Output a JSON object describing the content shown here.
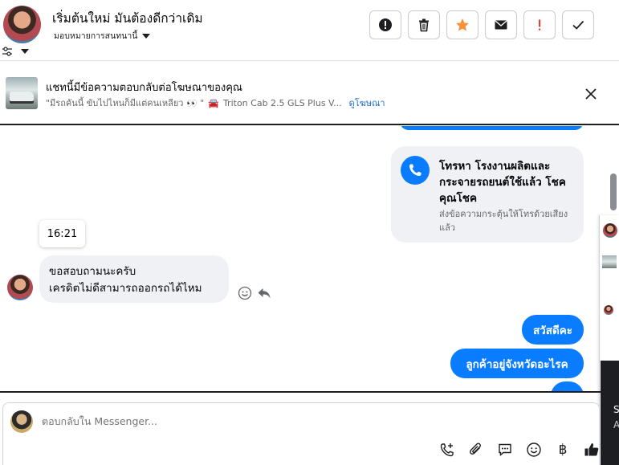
{
  "header": {
    "title": "เริ่มต้นใหม่ มันต้องดีกว่าเดิม",
    "assign_label": "มอบหมายการสนทนานี้",
    "actions": [
      {
        "name": "mark-spam-button",
        "icon": "exclamation-circle-icon"
      },
      {
        "name": "delete-button",
        "icon": "trash-icon"
      },
      {
        "name": "star-button",
        "icon": "star-icon"
      },
      {
        "name": "mark-unread-button",
        "icon": "envelope-icon"
      },
      {
        "name": "follow-up-button",
        "icon": "exclamation-icon"
      },
      {
        "name": "mark-done-button",
        "icon": "check-icon"
      }
    ]
  },
  "ad": {
    "title": "แชทนี้มีข้อความตอบกลับต่อโฆษณาของคุณ",
    "quote": "\"มีรถคันนี้ ขับไปไหนก็มีแต่คนเหลียว 👀 \"",
    "car": "🚘",
    "model": "Triton Cab 2.5 GLS Plus V...",
    "link": "ดูโฆษณา"
  },
  "messages": {
    "call_card": {
      "title": "โทรหา โรงงานผลิตและกระจายรถยนต์ใช้แล้ว โชคคุณโชค",
      "subtitle": "ส่งข้อความกระตุ้นให้โทรด้วยเสียงแล้ว"
    },
    "timestamp": "16:21",
    "incoming": {
      "line1": "ขอสอบถามนะครับ",
      "line2": "เครดิตไม่ดีสามารถออกรถได้ไหม"
    },
    "outgoing": [
      "สวัสดีคะ",
      "ลูกค้าอยู่จังหวัดอะไรค"
    ]
  },
  "side_panel": {
    "letter1": "S",
    "letter2": "A"
  },
  "composer": {
    "placeholder": "ตอบกลับใน Messenger...",
    "tools": [
      "phone-plus-icon",
      "paperclip-icon",
      "chat-template-icon",
      "emoji-icon",
      "baht-icon",
      "thumbs-up-icon"
    ],
    "baht_symbol": "฿"
  },
  "colors": {
    "accent": "#0a7cff",
    "star": "#f5923e",
    "alert": "#e4452a",
    "bubble_gray": "#eff1f4"
  }
}
